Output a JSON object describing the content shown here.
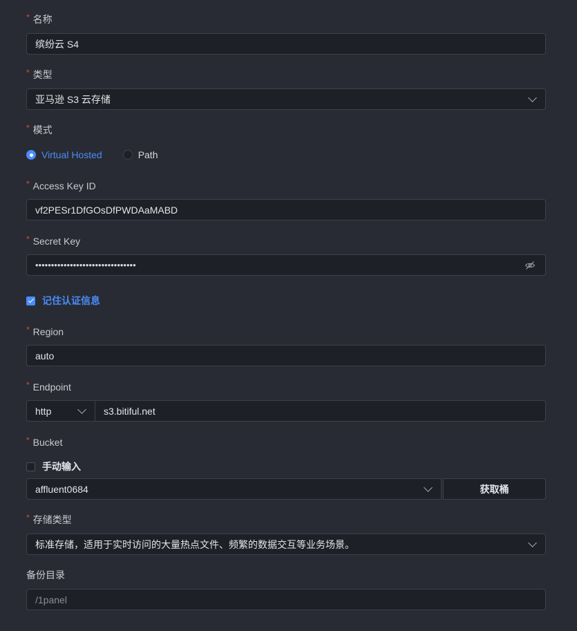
{
  "form": {
    "name": {
      "label": "名称",
      "required": true,
      "value": "缤纷云 S4"
    },
    "type": {
      "label": "类型",
      "required": true,
      "value": "亚马逊 S3 云存储"
    },
    "mode": {
      "label": "模式",
      "required": true,
      "options": [
        {
          "label": "Virtual Hosted",
          "selected": true
        },
        {
          "label": "Path",
          "selected": false
        }
      ]
    },
    "access_key": {
      "label": "Access Key ID",
      "required": true,
      "value": "vf2PESr1DfGOsDfPWDAaMABD"
    },
    "secret_key": {
      "label": "Secret Key",
      "required": true,
      "masked_value": "••••••••••••••••••••••••••••••••",
      "icon": "eye-hidden-icon"
    },
    "remember": {
      "label": "记住认证信息",
      "checked": true
    },
    "region": {
      "label": "Region",
      "required": true,
      "value": "auto"
    },
    "endpoint": {
      "label": "Endpoint",
      "required": true,
      "protocol": "http",
      "host": "s3.bitiful.net"
    },
    "bucket": {
      "label": "Bucket",
      "required": true,
      "manual_label": "手动输入",
      "manual_checked": false,
      "value": "affluent0684",
      "fetch_button": "获取桶"
    },
    "storage_class": {
      "label": "存储类型",
      "required": true,
      "value": "标准存储，适用于实时访问的大量热点文件、频繁的数据交互等业务场景。"
    },
    "backup_dir": {
      "label": "备份目录",
      "required": false,
      "placeholder": "/1panel"
    }
  },
  "colors": {
    "background": "#282b33",
    "input_bg": "#1d2026",
    "border": "#3d414b",
    "accent": "#4a8cf7",
    "required_star": "#e8443b"
  }
}
